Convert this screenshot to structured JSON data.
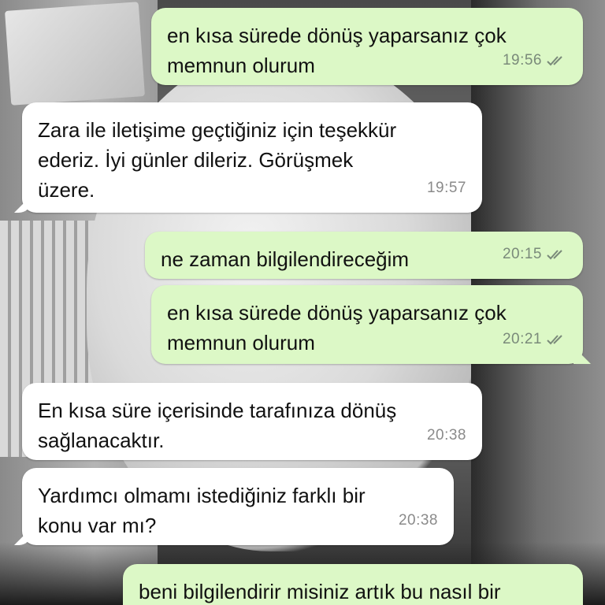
{
  "messages": [
    {
      "direction": "out",
      "text": "en kısa sürede dönüş yaparsanız çok\nmemnun olurum",
      "time": "19:56",
      "status_icon": "double-check-icon"
    },
    {
      "direction": "in",
      "text": "Zara ile iletişime geçtiğiniz için teşekkür\nederiz. İyi günler dileriz. Görüşmek\nüzere.",
      "time": "19:57"
    },
    {
      "direction": "out",
      "text": "ne zaman bilgilendireceğim",
      "time": "20:15",
      "status_icon": "double-check-icon"
    },
    {
      "direction": "out",
      "text": "en kısa sürede dönüş yaparsanız çok\nmemnun olurum",
      "time": "20:21",
      "status_icon": "double-check-icon"
    },
    {
      "direction": "in",
      "text": "En kısa süre içerisinde tarafınıza dönüş\nsağlanacaktır.",
      "time": "20:38"
    },
    {
      "direction": "in",
      "text": "Yardımcı olmamı istediğiniz farklı bir\nkonu var mı?",
      "time": "20:38"
    },
    {
      "direction": "out",
      "text": "beni bilgilendirir misiniz artık bu nasıl bir",
      "time": "",
      "status_icon": ""
    }
  ],
  "colors": {
    "outgoing_bubble": "#dcf8c6",
    "incoming_bubble": "#ffffff",
    "tick": "#7a8a7a"
  }
}
